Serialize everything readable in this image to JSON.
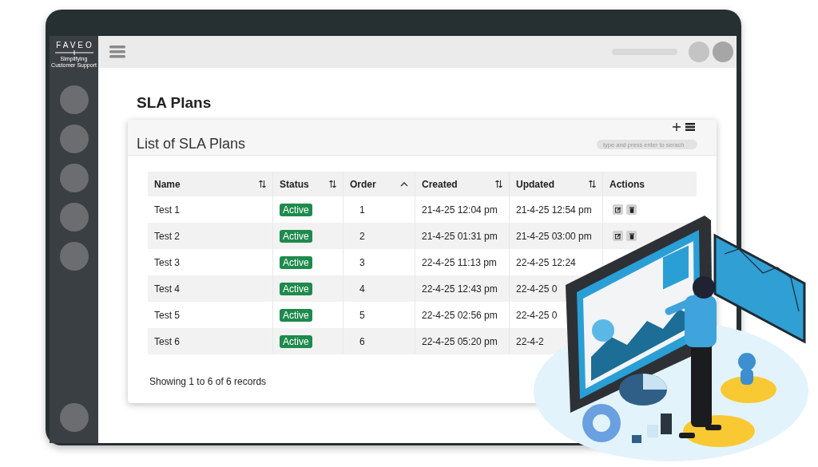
{
  "sidebar": {
    "logo": "FAVEO",
    "tagline": "Simplifying Customer Support"
  },
  "page_title": "SLA Plans",
  "card": {
    "title": "List of SLA Plans",
    "search": {
      "placeholder": "type and press enter to serach"
    }
  },
  "table": {
    "columns": [
      {
        "label": "Name",
        "sortable": true,
        "ascending": false
      },
      {
        "label": "Status",
        "sortable": true,
        "ascending": false
      },
      {
        "label": "Order",
        "sortable": true,
        "ascending": true
      },
      {
        "label": "Created",
        "sortable": true,
        "ascending": false
      },
      {
        "label": "Updated",
        "sortable": true,
        "ascending": false
      },
      {
        "label": "Actions",
        "sortable": false
      }
    ],
    "rows": [
      {
        "name": "Test 1",
        "status": "Active",
        "order": "1",
        "created": "21-4-25 12:04 pm",
        "updated": "21-4-25 12:54 pm",
        "actions": true
      },
      {
        "name": "Test 2",
        "status": "Active",
        "order": "2",
        "created": "21-4-25 01:31 pm",
        "updated": "21-4-25 03:00 pm",
        "actions": true
      },
      {
        "name": "Test 3",
        "status": "Active",
        "order": "3",
        "created": "22-4-25 11:13 pm",
        "updated": "22-4-25 12:24"
      },
      {
        "name": "Test 4",
        "status": "Active",
        "order": "4",
        "created": "22-4-25 12:43 pm",
        "updated": "22-4-25 0"
      },
      {
        "name": "Test 5",
        "status": "Active",
        "order": "5",
        "created": "22-4-25 02:56 pm",
        "updated": "22-4-25 0"
      },
      {
        "name": "Test 6",
        "status": "Active",
        "order": "6",
        "created": "22-4-25 05:20 pm",
        "updated": "22-4-2"
      }
    ]
  },
  "footer": "Showing 1 to 6 of 6 records"
}
